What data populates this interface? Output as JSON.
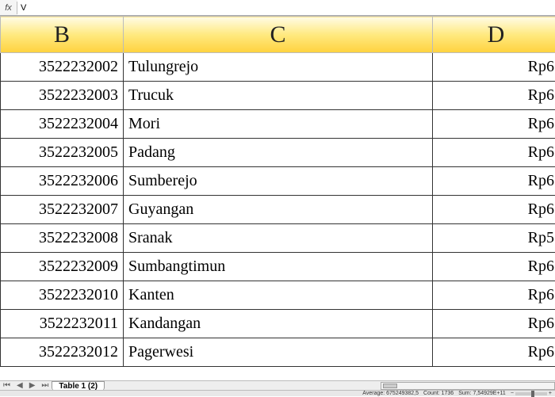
{
  "formula_bar": {
    "fx_label": "fx",
    "value": "V"
  },
  "columns": [
    {
      "key": "B",
      "label": "B"
    },
    {
      "key": "C",
      "label": "C"
    },
    {
      "key": "D",
      "label": "D"
    }
  ],
  "chart_data": {
    "type": "table",
    "title": "",
    "columns": [
      "B",
      "C",
      "D"
    ],
    "rows": [
      {
        "B": "3522232002",
        "C": "Tulungrejo",
        "D": "Rp6"
      },
      {
        "B": "3522232003",
        "C": "Trucuk",
        "D": "Rp6"
      },
      {
        "B": "3522232004",
        "C": "Mori",
        "D": "Rp6"
      },
      {
        "B": "3522232005",
        "C": "Padang",
        "D": "Rp6"
      },
      {
        "B": "3522232006",
        "C": "Sumberejo",
        "D": "Rp6"
      },
      {
        "B": "3522232007",
        "C": "Guyangan",
        "D": "Rp6"
      },
      {
        "B": "3522232008",
        "C": "Sranak",
        "D": "Rp5"
      },
      {
        "B": "3522232009",
        "C": "Sumbangtimun",
        "D": "Rp6"
      },
      {
        "B": "3522232010",
        "C": "Kanten",
        "D": "Rp6"
      },
      {
        "B": "3522232011",
        "C": "Kandangan",
        "D": "Rp6"
      },
      {
        "B": "3522232012",
        "C": "Pagerwesi",
        "D": "Rp6"
      }
    ]
  },
  "sheet_tab": {
    "nav_first": "⏮",
    "nav_prev": "◀",
    "nav_next": "▶",
    "nav_last": "⏭",
    "active": "Table 1 (2)"
  },
  "status": {
    "average_label": "Average:",
    "average_value": "675249382,5",
    "count_label": "Count:",
    "count_value": "1736",
    "sum_label": "Sum:",
    "sum_value": "7,54929E+11",
    "zoom_minus": "−",
    "zoom_plus": "+"
  }
}
